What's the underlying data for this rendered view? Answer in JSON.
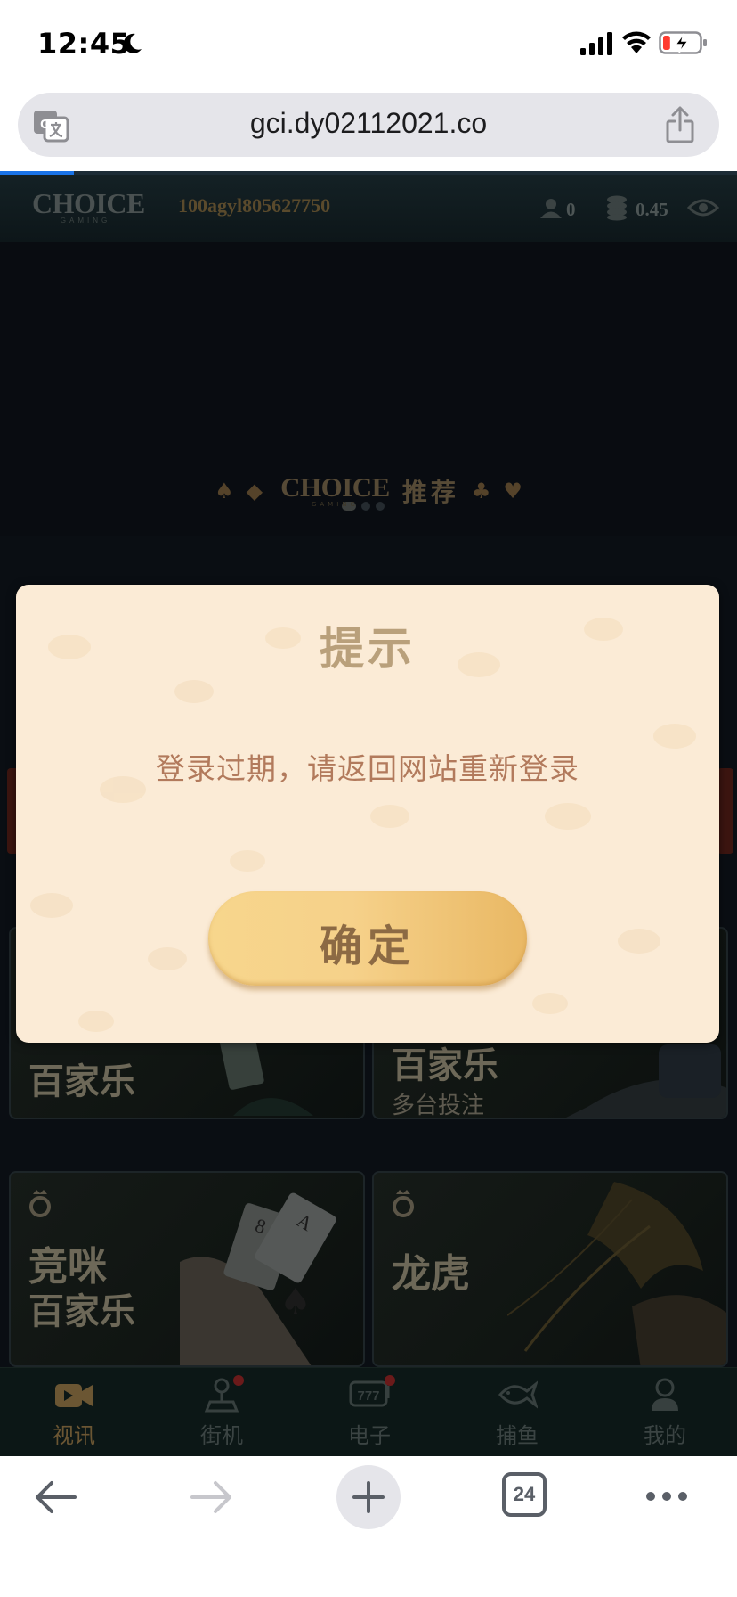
{
  "status_bar": {
    "time": "12:45",
    "battery_level": 0.2,
    "battery_charging": true,
    "icons": [
      "moon-icon",
      "cellular-signal-icon",
      "wifi-icon",
      "battery-charging-icon"
    ]
  },
  "browser": {
    "url": "gci.dy02112021.co",
    "load_progress": 0.1,
    "tab_count": "24",
    "icons": [
      "translate-icon",
      "share-icon",
      "back-arrow-icon",
      "forward-arrow-icon",
      "plus-icon",
      "more-icon"
    ]
  },
  "game_header": {
    "logo_text": "CHOICE",
    "logo_subtext": "GAMING",
    "account_id": "100agyl805627750",
    "online_count": "0",
    "balance": "0.45"
  },
  "carousel": {
    "slide_count": 3,
    "active_index": 0
  },
  "recommend": {
    "logo_text": "CHOICE",
    "logo_subtext": "GAMING",
    "label": "推荐"
  },
  "game_cards": [
    {
      "title": "",
      "subtitle": "",
      "title_line2": "百家乐"
    },
    {
      "title": "百家乐",
      "subtitle": "多台投注"
    },
    {
      "title_line1": "竞咪",
      "title_line2": "百家乐"
    },
    {
      "title": "龙虎"
    }
  ],
  "tabs": [
    {
      "label": "视讯",
      "icon": "video-camera-icon",
      "active": true,
      "badge": false
    },
    {
      "label": "街机",
      "icon": "joystick-icon",
      "active": false,
      "badge": true
    },
    {
      "label": "电子",
      "icon": "slot-777-icon",
      "active": false,
      "badge": true
    },
    {
      "label": "捕鱼",
      "icon": "fish-icon",
      "active": false,
      "badge": false
    },
    {
      "label": "我的",
      "icon": "user-icon",
      "active": false,
      "badge": false
    }
  ],
  "dialog": {
    "title": "提示",
    "message": "登录过期，请返回网站重新登录",
    "confirm_label": "确定"
  },
  "colors": {
    "dialog_bg": "#fbebd6",
    "button_gold": "#f6d18a",
    "page_bg": "#0a0e13",
    "accent_link": "#1a73e8"
  }
}
